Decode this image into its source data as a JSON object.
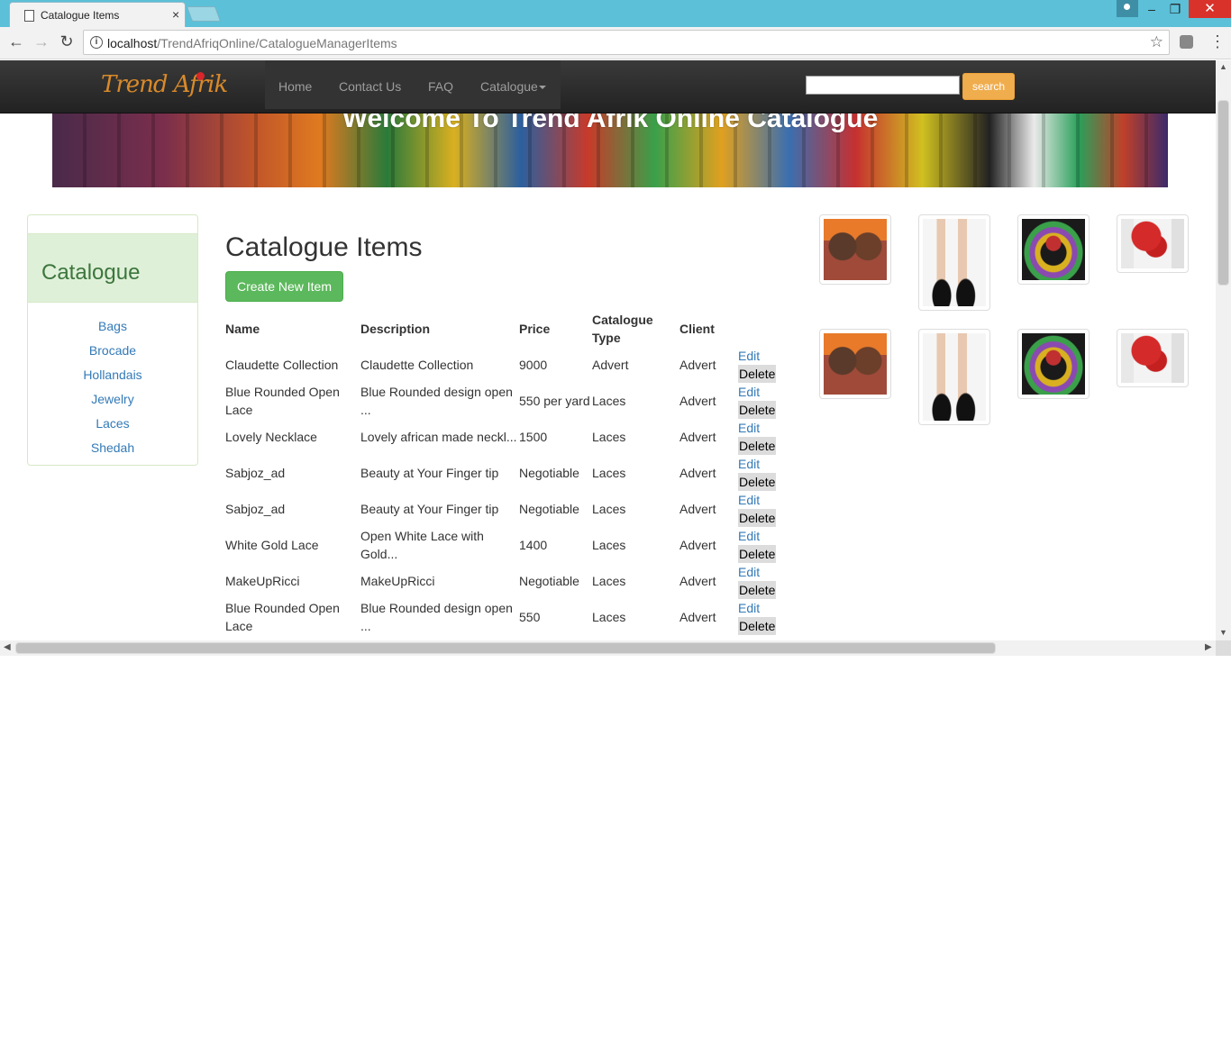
{
  "browser": {
    "tab_title": "Catalogue Items",
    "tab_close": "×",
    "url_host": "localhost",
    "url_path": "/TrendAfriqOnline/CatalogueManagerItems",
    "win_minimize": "–",
    "win_restore": "❐",
    "win_close": "✕",
    "back": "←",
    "forward": "→",
    "reload": "↻",
    "info": "i",
    "star": "☆",
    "menu": "⋮"
  },
  "navbar": {
    "brand": "Trend Afrik",
    "links": [
      "Home",
      "Contact Us",
      "FAQ",
      "Catalogue"
    ],
    "search_button": "search"
  },
  "banner": {
    "text": "Welcome To Trend Afrik Online Catalogue"
  },
  "sidebar": {
    "title": "Catalogue",
    "items": [
      "Bags",
      "Brocade",
      "Hollandais",
      "Jewelry",
      "Laces",
      "Shedah"
    ]
  },
  "main": {
    "title": "Catalogue Items",
    "create_button": "Create New Item",
    "columns": [
      "Name",
      "Description",
      "Price",
      "Catalogue",
      "Type",
      "Client"
    ],
    "edit_label": "Edit",
    "delete_label": "Delete",
    "rows": [
      {
        "name": [
          "Claudette Collection"
        ],
        "desc": [
          "Claudette Collection"
        ],
        "price": "9000",
        "type": "Advert",
        "client": "Advert"
      },
      {
        "name": [
          "Blue Rounded Open",
          "Lace"
        ],
        "desc": [
          "Blue Rounded design open",
          "..."
        ],
        "price": "550 per yard",
        "type": "Laces",
        "client": "Advert"
      },
      {
        "name": [
          "Lovely Necklace"
        ],
        "desc": [
          "Lovely african made neckl..."
        ],
        "price": "1500",
        "type": "Laces",
        "client": "Advert"
      },
      {
        "name": [
          "Sabjoz_ad"
        ],
        "desc": [
          "Beauty at Your Finger tip"
        ],
        "price": "Negotiable",
        "type": "Laces",
        "client": "Advert"
      },
      {
        "name": [
          "Sabjoz_ad"
        ],
        "desc": [
          "Beauty at Your Finger tip"
        ],
        "price": "Negotiable",
        "type": "Laces",
        "client": "Advert"
      },
      {
        "name": [
          "White Gold Lace"
        ],
        "desc": [
          "Open White Lace with",
          "Gold..."
        ],
        "price": "1400",
        "type": "Laces",
        "client": "Advert"
      },
      {
        "name": [
          "MakeUpRicci"
        ],
        "desc": [
          "MakeUpRicci"
        ],
        "price": "Negotiable",
        "type": "Laces",
        "client": "Advert"
      },
      {
        "name": [
          "Blue Rounded Open",
          "Lace"
        ],
        "desc": [
          "Blue Rounded design open",
          "..."
        ],
        "price": "550",
        "type": "Laces",
        "client": "Advert"
      }
    ]
  },
  "gallery": {
    "images": [
      "women-photo",
      "heels-photo",
      "necklace-photo",
      "beads-photo",
      "women-photo",
      "heels-photo",
      "necklace-photo",
      "beads-photo"
    ]
  },
  "colors": {
    "titlebar": "#5bc0d8",
    "navbar": "#222222",
    "search_button": "#f0ad4e",
    "create_button": "#5cb85c",
    "link": "#337ab7",
    "panel_heading": "#dff0d8"
  }
}
